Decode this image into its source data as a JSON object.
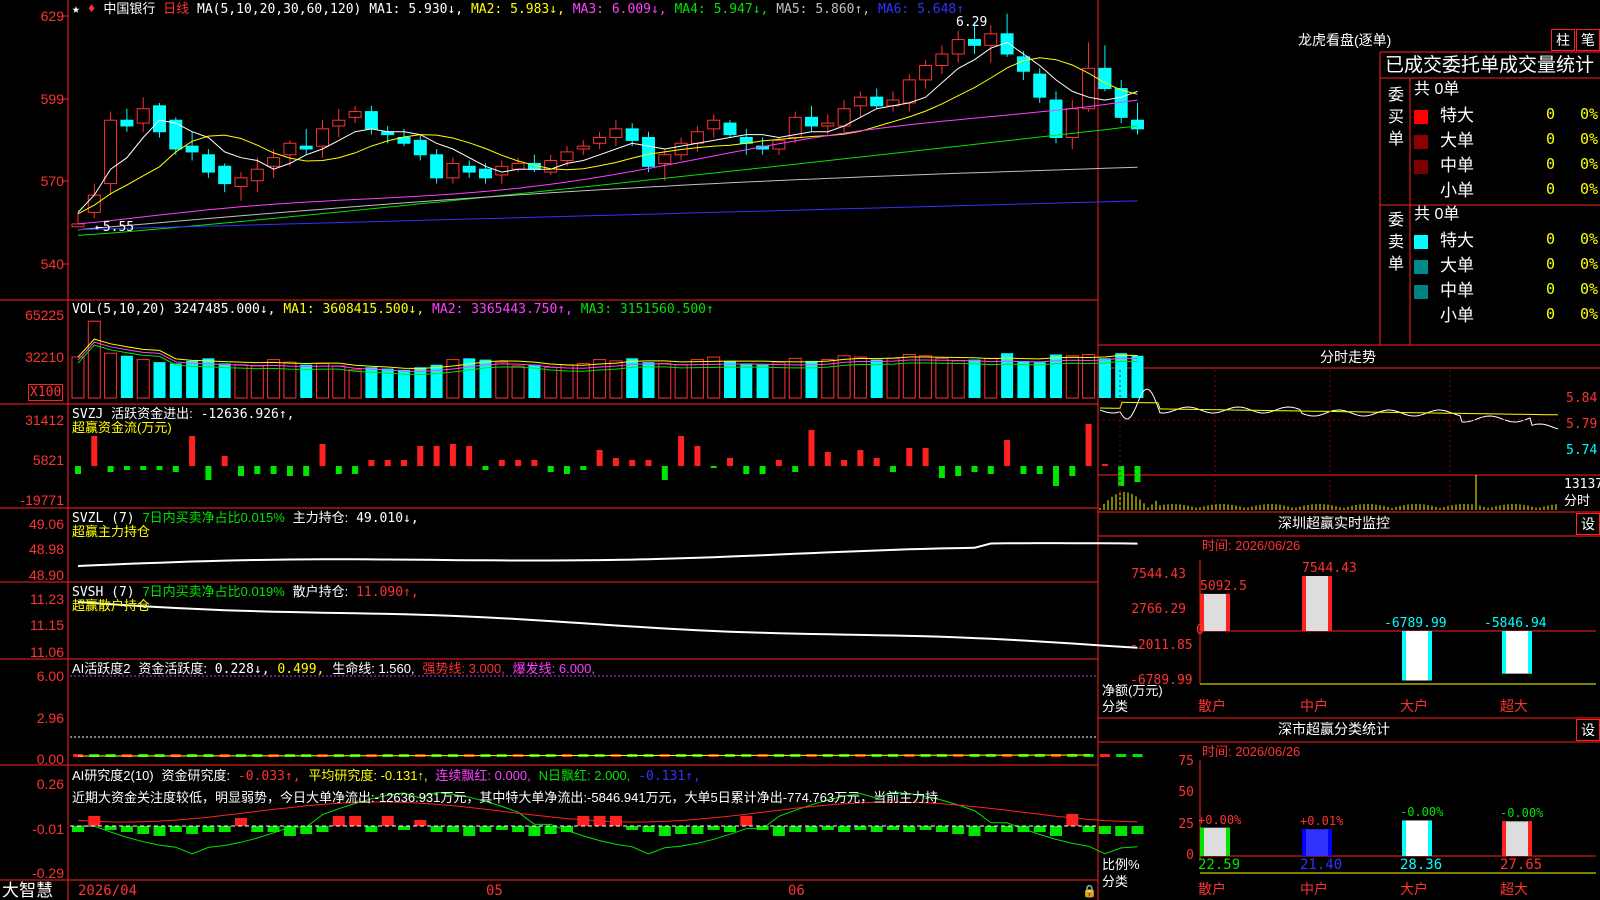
{
  "app": {
    "brand": "大智慧",
    "stock_name": "中国银行",
    "period": "日线"
  },
  "main_chart": {
    "ma_header": "MA(5,10,20,30,60,120)",
    "ma_items": [
      {
        "label": "MA1:",
        "value": "5.930",
        "arrow": "↓",
        "color": "#ffffff"
      },
      {
        "label": "MA2:",
        "value": "5.983",
        "arrow": "↓",
        "color": "#ffff00"
      },
      {
        "label": "MA3:",
        "value": "6.009",
        "arrow": "↓",
        "color": "#ff40ff"
      },
      {
        "label": "MA4:",
        "value": "5.947",
        "arrow": "↓",
        "color": "#00e400"
      },
      {
        "label": "MA5:",
        "value": "5.860",
        "arrow": "↑",
        "color": "#c0c0c0"
      },
      {
        "label": "MA6:",
        "value": "5.648",
        "arrow": "↑",
        "color": "#3232ff"
      }
    ],
    "yticks": [
      "629",
      "599",
      "570",
      "540"
    ],
    "high_label": "6.29",
    "low_label": "5.55",
    "x_labels": [
      "2026/04",
      "05",
      "06"
    ]
  },
  "vol_panel": {
    "title": "VOL(5,10,20)",
    "value": "3247485.000",
    "arrow": "↓",
    "ma1": "MA1: 3608415.500↓,",
    "ma2": "MA2: 3365443.750↑,",
    "ma3": "MA3: 3151560.500↑",
    "yticks": [
      "65225",
      "32210"
    ],
    "unit": "X100"
  },
  "svzj": {
    "title": "SVZJ",
    "label": "活跃资金进出:",
    "value": "-12636.926↑,",
    "subtitle": "超赢资金流(万元)",
    "yticks": [
      "31412",
      "5821",
      "-19771"
    ]
  },
  "svzl": {
    "title": "SVZL (7)",
    "pct_label": "7日内买卖净占比0.015%",
    "label": "主力持仓:",
    "value": "49.010↓,",
    "subtitle": "超赢主力持仓",
    "yticks": [
      "49.06",
      "48.98",
      "48.90"
    ]
  },
  "svsh": {
    "title": "SVSH (7)",
    "pct_label": "7日内买卖净占比0.019%",
    "label": "散户持仓:",
    "value": "11.090↑,",
    "subtitle": "超赢散户持仓",
    "yticks": [
      "11.23",
      "11.15",
      "11.06"
    ]
  },
  "ai_active": {
    "title": "AI活跃度2",
    "label": "资金活跃度:",
    "v1": "0.228↓,",
    "v2": "0.499,",
    "life": "生命线: 1.560,",
    "strong": "强势线: 3.000,",
    "burst": "爆发线: 6.000,",
    "yticks": [
      "6.00",
      "2.96",
      "0.00"
    ]
  },
  "ai_research": {
    "title": "AI研究度2(10)",
    "label": "资金研究度:",
    "value": "-0.033↑,",
    "avg": "平均研究度: -0.131↑,",
    "red": "连续飘红: 0.000,",
    "nred": "N日飘红: 2.000,",
    "last": "-0.131↑,",
    "note": "近期大资金关注度较低，明显弱势，今日大单净流出:-12636.931万元，其中特大单净流出:-5846.941万元，大单5日累计净出-774.763万元，当前主力持",
    "yticks": [
      "0.26",
      "-0.01",
      "-0.29"
    ]
  },
  "dragon": {
    "title": "龙虎看盘(逐单)",
    "btn1": "柱",
    "btn2": "笔",
    "tabs": "已成交委托单成交量统计",
    "buy": {
      "side": "委买单",
      "total": "共 0单",
      "rows": [
        {
          "name": "特大",
          "val": "0",
          "pct": "0%",
          "color": "#ff0000"
        },
        {
          "name": "大单",
          "val": "0",
          "pct": "0%",
          "color": "#8b0000"
        },
        {
          "name": "中单",
          "val": "0",
          "pct": "0%",
          "color": "#7a0000"
        },
        {
          "name": "小单",
          "val": "0",
          "pct": "0%",
          "color": "#000000"
        }
      ]
    },
    "sell": {
      "side": "委卖单",
      "total": "共 0单",
      "rows": [
        {
          "name": "特大",
          "val": "0",
          "pct": "0%",
          "color": "#00ffff"
        },
        {
          "name": "大单",
          "val": "0",
          "pct": "0%",
          "color": "#008b8b"
        },
        {
          "name": "中单",
          "val": "0",
          "pct": "0%",
          "color": "#008080"
        },
        {
          "name": "小单",
          "val": "0",
          "pct": "0%",
          "color": "#000000"
        }
      ]
    }
  },
  "intraday": {
    "title": "分时走势",
    "yticks": [
      "5.84",
      "5.79",
      "5.74"
    ],
    "vol_tick": "13137",
    "vol_label": "分时"
  },
  "monitor": {
    "title": "深圳超赢实时监控",
    "btn": "设",
    "time": "时间: 2026/06/26",
    "yticks": [
      "7544.43",
      "2766.29",
      "0",
      "-2011.85",
      "-6789.99"
    ],
    "ylabel1": "净额(万元)",
    "ylabel2": "分类",
    "bars": [
      {
        "name": "散户",
        "value": "5092.5"
      },
      {
        "name": "中户",
        "value": "7544.43"
      },
      {
        "name": "大户",
        "value": "-6789.99"
      },
      {
        "name": "超大",
        "value": "-5846.94"
      }
    ]
  },
  "classify": {
    "title": "深市超赢分类统计",
    "btn": "设",
    "time": "时间: 2026/06/26",
    "yticks": [
      "75",
      "50",
      "25",
      "0"
    ],
    "ylabel1": "比例%",
    "ylabel2": "分类",
    "bars": [
      {
        "name": "散户",
        "pct": "+0.00%",
        "value": "22.59"
      },
      {
        "name": "中户",
        "pct": "+0.01%",
        "value": "21.40"
      },
      {
        "name": "大户",
        "pct": "-0.00%",
        "value": "28.36"
      },
      {
        "name": "超大",
        "pct": "-0.00%",
        "value": "27.65"
      }
    ]
  },
  "chart_data": [
    {
      "type": "candlestick",
      "title": "中国银行 日线",
      "ylim": [
        5.4,
        6.32
      ],
      "candles": [
        [
          5.55,
          5.6,
          5.55,
          5.56
        ],
        [
          5.6,
          5.7,
          5.58,
          5.66
        ],
        [
          5.7,
          5.95,
          5.66,
          5.92
        ],
        [
          5.92,
          5.96,
          5.88,
          5.9
        ],
        [
          5.91,
          6.0,
          5.88,
          5.96
        ],
        [
          5.97,
          5.98,
          5.86,
          5.88
        ],
        [
          5.92,
          5.93,
          5.8,
          5.82
        ],
        [
          5.83,
          5.88,
          5.78,
          5.81
        ],
        [
          5.8,
          5.82,
          5.72,
          5.74
        ],
        [
          5.76,
          5.77,
          5.67,
          5.7
        ],
        [
          5.69,
          5.74,
          5.64,
          5.72
        ],
        [
          5.71,
          5.79,
          5.67,
          5.75
        ],
        [
          5.76,
          5.82,
          5.72,
          5.79
        ],
        [
          5.8,
          5.85,
          5.76,
          5.84
        ],
        [
          5.83,
          5.89,
          5.8,
          5.82
        ],
        [
          5.83,
          5.92,
          5.79,
          5.89
        ],
        [
          5.9,
          5.96,
          5.86,
          5.92
        ],
        [
          5.93,
          5.97,
          5.91,
          5.95
        ],
        [
          5.95,
          5.97,
          5.87,
          5.89
        ],
        [
          5.88,
          5.9,
          5.84,
          5.87
        ],
        [
          5.86,
          5.89,
          5.83,
          5.84
        ],
        [
          5.85,
          5.87,
          5.78,
          5.8
        ],
        [
          5.8,
          5.82,
          5.7,
          5.72
        ],
        [
          5.72,
          5.79,
          5.7,
          5.77
        ],
        [
          5.76,
          5.78,
          5.72,
          5.74
        ],
        [
          5.75,
          5.77,
          5.7,
          5.72
        ],
        [
          5.73,
          5.78,
          5.7,
          5.76
        ],
        [
          5.75,
          5.79,
          5.74,
          5.77
        ],
        [
          5.77,
          5.8,
          5.74,
          5.75
        ],
        [
          5.74,
          5.8,
          5.73,
          5.78
        ],
        [
          5.78,
          5.83,
          5.76,
          5.81
        ],
        [
          5.82,
          5.85,
          5.8,
          5.83
        ],
        [
          5.84,
          5.88,
          5.82,
          5.86
        ],
        [
          5.86,
          5.92,
          5.83,
          5.89
        ],
        [
          5.89,
          5.91,
          5.83,
          5.85
        ],
        [
          5.86,
          5.88,
          5.74,
          5.76
        ],
        [
          5.77,
          5.82,
          5.71,
          5.8
        ],
        [
          5.8,
          5.86,
          5.78,
          5.84
        ],
        [
          5.84,
          5.9,
          5.81,
          5.88
        ],
        [
          5.89,
          5.94,
          5.86,
          5.92
        ],
        [
          5.91,
          5.92,
          5.86,
          5.87
        ],
        [
          5.86,
          5.89,
          5.8,
          5.84
        ],
        [
          5.83,
          5.86,
          5.8,
          5.82
        ],
        [
          5.82,
          5.86,
          5.8,
          5.85
        ],
        [
          5.86,
          5.95,
          5.84,
          5.93
        ],
        [
          5.93,
          5.97,
          5.88,
          5.9
        ],
        [
          5.9,
          5.94,
          5.87,
          5.91
        ],
        [
          5.9,
          5.99,
          5.88,
          5.96
        ],
        [
          5.97,
          6.02,
          5.93,
          6.0
        ],
        [
          6.0,
          6.03,
          5.96,
          5.97
        ],
        [
          5.97,
          6.02,
          5.95,
          5.99
        ],
        [
          5.98,
          6.08,
          5.95,
          6.06
        ],
        [
          6.06,
          6.13,
          6.03,
          6.11
        ],
        [
          6.11,
          6.18,
          6.08,
          6.15
        ],
        [
          6.15,
          6.23,
          6.12,
          6.2
        ],
        [
          6.2,
          6.26,
          6.15,
          6.18
        ],
        [
          6.18,
          6.25,
          6.12,
          6.22
        ],
        [
          6.22,
          6.29,
          6.14,
          6.15
        ],
        [
          6.14,
          6.16,
          6.06,
          6.09
        ],
        [
          6.08,
          6.1,
          5.98,
          6.0
        ],
        [
          5.99,
          6.02,
          5.84,
          5.86
        ],
        [
          5.86,
          5.99,
          5.82,
          5.96
        ],
        [
          5.96,
          6.19,
          5.95,
          6.1
        ],
        [
          6.1,
          6.18,
          6.02,
          6.03
        ],
        [
          6.03,
          6.06,
          5.91,
          5.93
        ],
        [
          5.92,
          5.98,
          5.87,
          5.89
        ]
      ],
      "ma1": [
        5.6,
        5.66,
        5.75,
        5.79,
        5.86,
        5.92,
        5.91,
        5.88,
        5.86,
        5.81,
        5.79,
        5.78,
        5.75,
        5.77,
        5.8,
        5.82,
        5.85,
        5.88,
        5.89,
        5.88,
        5.88,
        5.87,
        5.84,
        5.82,
        5.79,
        5.76,
        5.74,
        5.75,
        5.75,
        5.75,
        5.77,
        5.78,
        5.8,
        5.82,
        5.84,
        5.83,
        5.82,
        5.83,
        5.84,
        5.85,
        5.86,
        5.87,
        5.87,
        5.86,
        5.87,
        5.88,
        5.88,
        5.9,
        5.93,
        5.96,
        5.97,
        5.98,
        6.0,
        6.05,
        6.1,
        6.13,
        6.17,
        6.19,
        6.15,
        6.11,
        6.06,
        6.02,
        6.0,
        5.99,
        6.0,
        6.02
      ]
    },
    {
      "type": "bar",
      "title": "深圳超赢实时监控",
      "categories": [
        "散户",
        "中户",
        "大户",
        "超大"
      ],
      "values": [
        5092.5,
        7544.43,
        -6789.99,
        -5846.94
      ],
      "ylim": [
        -6789.99,
        7544.43
      ]
    },
    {
      "type": "bar",
      "title": "深市超赢分类统计",
      "categories": [
        "散户",
        "中户",
        "大户",
        "超大"
      ],
      "values": [
        22.59,
        21.4,
        28.36,
        27.65
      ],
      "ylim": [
        0,
        75
      ]
    }
  ]
}
